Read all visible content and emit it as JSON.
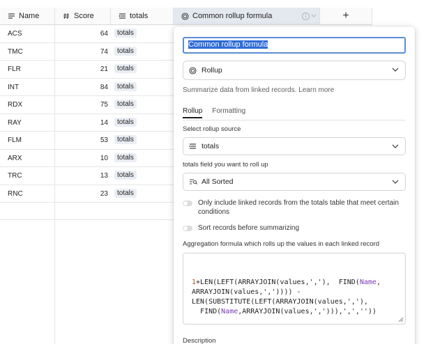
{
  "columns": {
    "name": {
      "label": "Name",
      "icon": "text-lines-icon"
    },
    "score": {
      "label": "Score",
      "icon": "hash-icon"
    },
    "totals": {
      "label": "totals",
      "icon": "link-lines-icon"
    },
    "rollup": {
      "label": "Common rollup formula",
      "icon": "rollup-icon"
    },
    "add": {
      "label": "+"
    }
  },
  "rows": [
    {
      "name": "ACS",
      "score": "64",
      "totals": "totals"
    },
    {
      "name": "TMC",
      "score": "74",
      "totals": "totals"
    },
    {
      "name": "FLR",
      "score": "21",
      "totals": "totals"
    },
    {
      "name": "INT",
      "score": "84",
      "totals": "totals"
    },
    {
      "name": "RDX",
      "score": "75",
      "totals": "totals"
    },
    {
      "name": "RAY",
      "score": "14",
      "totals": "totals"
    },
    {
      "name": "FLM",
      "score": "53",
      "totals": "totals"
    },
    {
      "name": "ARX",
      "score": "10",
      "totals": "totals"
    },
    {
      "name": "TRC",
      "score": "13",
      "totals": "totals"
    },
    {
      "name": "RNC",
      "score": "23",
      "totals": "totals"
    }
  ],
  "panel": {
    "field_name": "Common rollup formula",
    "field_type": "Rollup",
    "summary": "Summarize data from linked records.",
    "learn_more": "Learn more",
    "tabs": [
      "Rollup",
      "Formatting"
    ],
    "source_label": "Select rollup source",
    "source_value": "totals",
    "field_label": "totals field you want to roll up",
    "field_value": "All Sorted",
    "toggle1": "Only include linked records from the totals table that meet certain conditions",
    "toggle2": "Sort records before summarizing",
    "formula_label": "Aggregation formula which rolls up the values in each linked record",
    "formula_lines": [
      "1+LEN(LEFT(ARRAYJOIN(values,','),  FIND(Name,",
      "ARRAYJOIN(values,',')))) -",
      "LEN(SUBSTITUTE(LEFT(ARRAYJOIN(values,','),",
      "  FIND(Name,ARRAYJOIN(values,','))),',',''))"
    ],
    "description_label": "Description"
  },
  "colors": {
    "accent": "#2e6bd6",
    "header_active": "#e4e8ef",
    "tag_bg": "#e9edf3",
    "formula_field": "#7b3ab8"
  }
}
